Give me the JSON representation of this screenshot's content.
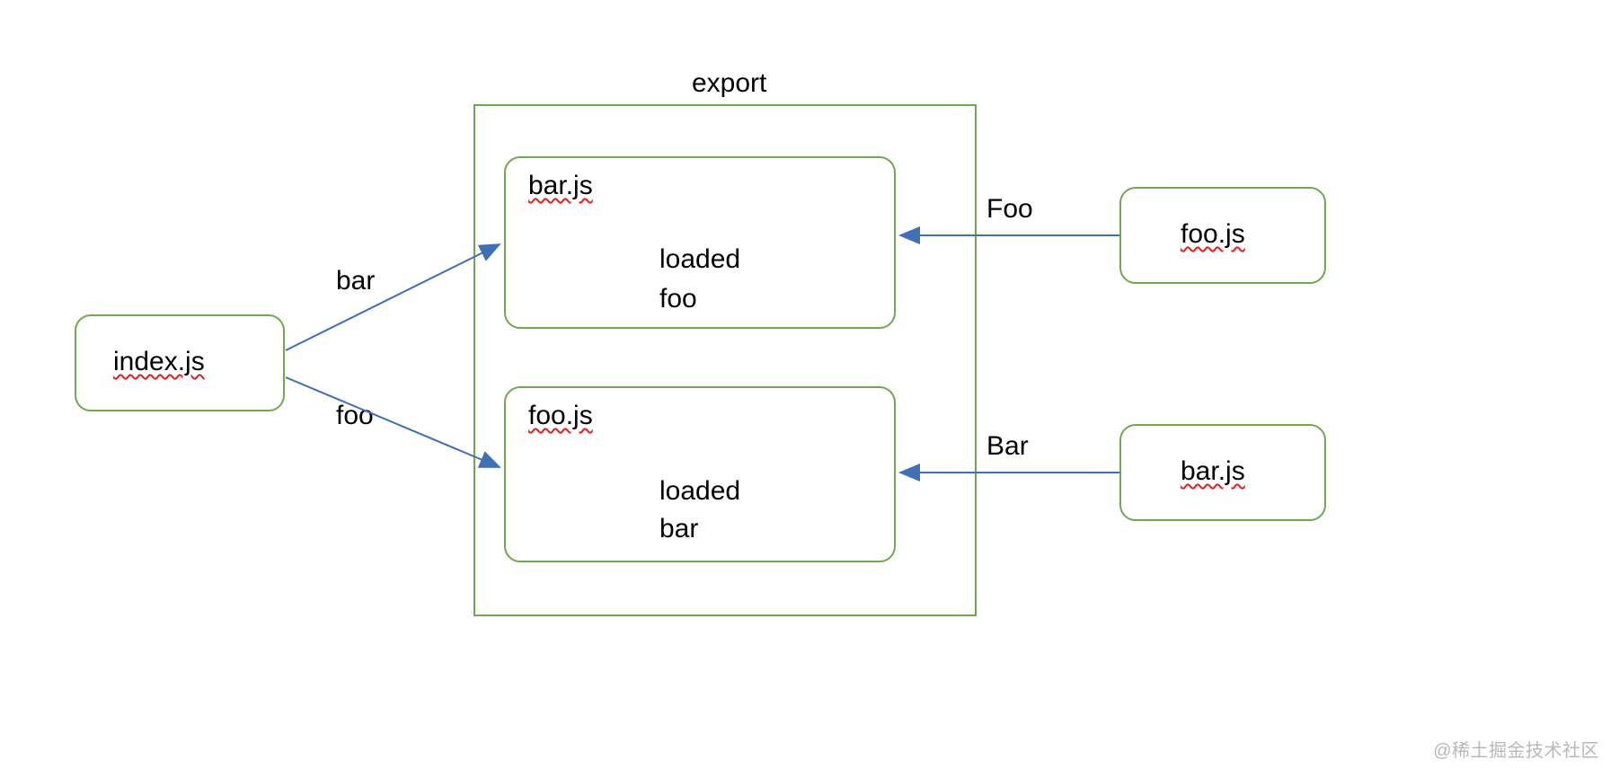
{
  "title": "export",
  "nodes": {
    "index": "index.js",
    "barModule": {
      "name": "bar.js",
      "body1": "loaded",
      "body2": "foo"
    },
    "fooModule": {
      "name": "foo.js",
      "body1": "loaded",
      "body2": "bar"
    },
    "rightFoo": "foo.js",
    "rightBar": "bar.js"
  },
  "edges": {
    "indexToBar": "bar",
    "indexToFoo": "foo",
    "fooToBar": "Foo",
    "barToFoo": "Bar"
  },
  "watermark": "@稀土掘金技术社区"
}
